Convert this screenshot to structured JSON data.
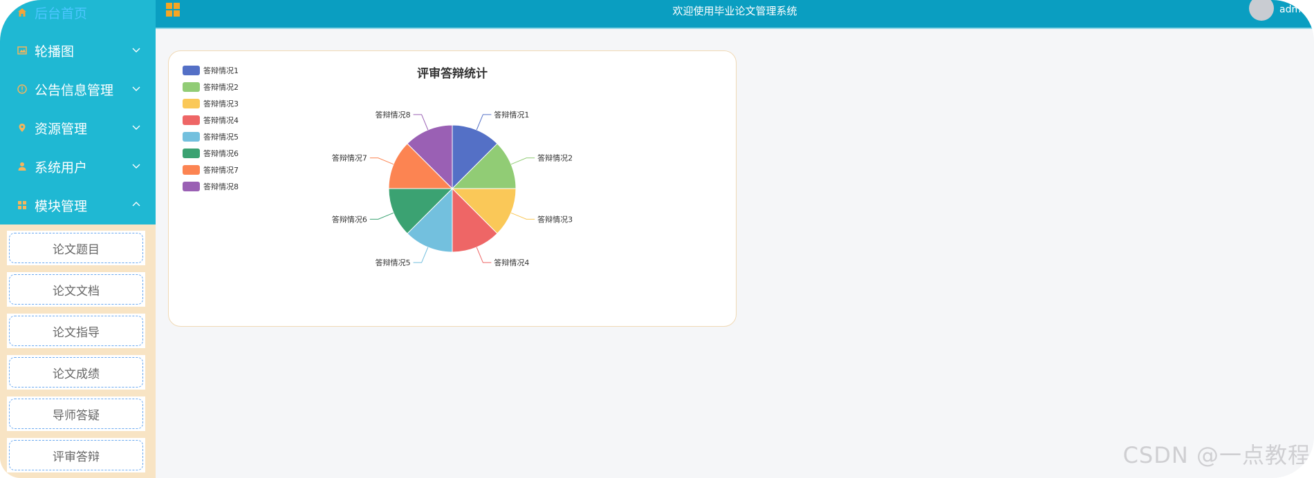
{
  "sidebar": {
    "home": "后台首页",
    "menus": [
      {
        "label": "轮播图",
        "icon": "image-icon"
      },
      {
        "label": "公告信息管理",
        "icon": "info-icon"
      },
      {
        "label": "资源管理",
        "icon": "location-icon"
      },
      {
        "label": "系统用户",
        "icon": "user-icon"
      },
      {
        "label": "模块管理",
        "icon": "grid-icon"
      }
    ],
    "submenus": [
      "论文题目",
      "论文文档",
      "论文指导",
      "论文成绩",
      "导师答疑",
      "评审答辩"
    ]
  },
  "header": {
    "title": "欢迎使用毕业论文管理系统",
    "user": "admin"
  },
  "watermark": "CSDN @一点教程",
  "colors": {
    "sidebar_bg": "#1fb8d3",
    "header_bg": "#0a9ec1",
    "submenu_bg": "#f8e4c4"
  },
  "chart_data": {
    "type": "pie",
    "title": "评审答辩统计",
    "legend_position": "top-left",
    "categories": [
      "答辩情况1",
      "答辩情况2",
      "答辩情况3",
      "答辩情况4",
      "答辩情况5",
      "答辩情况6",
      "答辩情况7",
      "答辩情况8"
    ],
    "values": [
      1,
      1,
      1,
      1,
      1,
      1,
      1,
      1
    ],
    "colors": [
      "#5470c6",
      "#91cc75",
      "#fac858",
      "#ee6666",
      "#73c0de",
      "#3ba272",
      "#fc8452",
      "#9a60b4"
    ]
  }
}
